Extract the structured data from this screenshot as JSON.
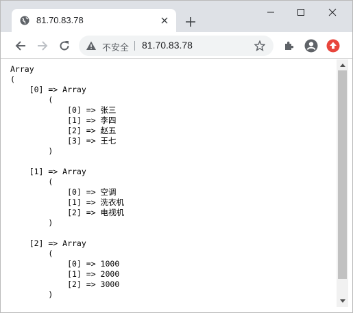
{
  "tab": {
    "title": "81.70.83.78"
  },
  "omnibox": {
    "security_label": "不安全",
    "url": "81.70.83.78"
  },
  "icons": {
    "favicon": "globe-icon",
    "tab_close": "close-icon",
    "new_tab": "plus-icon",
    "minimize": "minimize-icon",
    "maximize": "maximize-icon",
    "close_window": "close-icon",
    "back": "arrow-left-icon",
    "forward": "arrow-right-icon",
    "reload": "reload-icon",
    "info": "info-icon",
    "bookmark": "star-icon",
    "extensions": "puzzle-icon",
    "profile": "avatar-icon",
    "update": "update-icon"
  },
  "colors": {
    "update_badge": "#e8453c",
    "tab_strip": "#dee1e6",
    "omnibox_bg": "#f1f3f4"
  },
  "page": {
    "lines": [
      "Array",
      "(",
      "    [0] => Array",
      "        (",
      "            [0] => 张三",
      "            [1] => 李四",
      "            [2] => 赵五",
      "            [3] => 王七",
      "        )",
      "",
      "    [1] => Array",
      "        (",
      "            [0] => 空调",
      "            [1] => 洗衣机",
      "            [2] => 电视机",
      "        )",
      "",
      "    [2] => Array",
      "        (",
      "            [0] => 1000",
      "            [1] => 2000",
      "            [2] => 3000",
      "        )"
    ]
  }
}
